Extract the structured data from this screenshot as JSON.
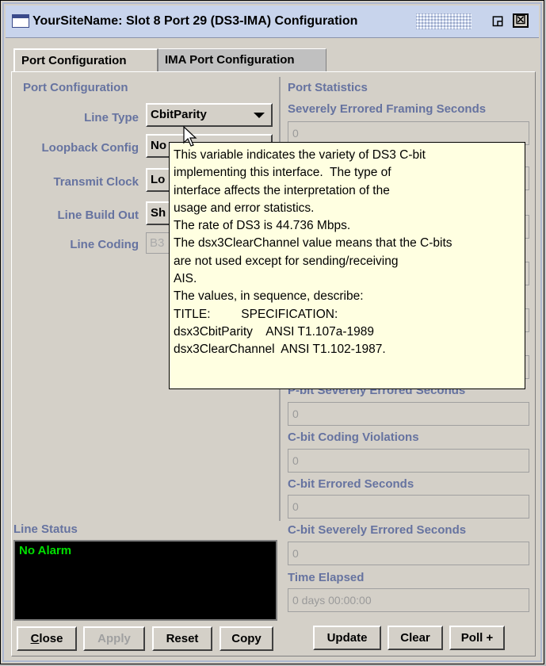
{
  "window": {
    "title": "YourSiteName: Slot 8 Port 29 (DS3-IMA) Configuration",
    "restore_glyph": "◲",
    "close_glyph": "☒"
  },
  "tabs": [
    {
      "label": "Port Configuration",
      "active": true
    },
    {
      "label": "IMA Port Configuration",
      "active": false
    }
  ],
  "port_config": {
    "heading": "Port Configuration",
    "fields": [
      {
        "label": "Line Type",
        "value": "CbitParity"
      },
      {
        "label": "Loopback Config",
        "value": "No"
      },
      {
        "label": "Transmit Clock",
        "value": "Lo"
      },
      {
        "label": "Line Build Out",
        "value": "Sh"
      },
      {
        "label": "Line Coding",
        "value": "B3"
      }
    ]
  },
  "port_stats": {
    "heading": "Port Statistics",
    "items": [
      {
        "label": "Severely Errored Framing Seconds",
        "value": "0"
      },
      {
        "label": "",
        "value": ""
      },
      {
        "label": "",
        "value": ""
      },
      {
        "label": "",
        "value": ""
      },
      {
        "label": "",
        "value": ""
      },
      {
        "label": "",
        "value": ""
      },
      {
        "label": "P-bit Severely Errored Seconds",
        "value": "0"
      },
      {
        "label": "C-bit Coding Violations",
        "value": "0"
      },
      {
        "label": "C-bit Errored Seconds",
        "value": "0"
      },
      {
        "label": "C-bit Severely Errored Seconds",
        "value": "0"
      },
      {
        "label": "Time Elapsed",
        "value": "0 days  00:00:00"
      }
    ]
  },
  "line_status": {
    "heading": "Line Status",
    "alarm_text": "No Alarm"
  },
  "buttons_left": {
    "close_u": "C",
    "close_rest": "lose",
    "apply": "Apply",
    "reset": "Reset",
    "copy": "Copy"
  },
  "buttons_right": {
    "update": "Update",
    "clear": "Clear",
    "poll": "Poll +"
  },
  "tooltip": {
    "lines": [
      "This variable indicates the variety of DS3 C-bit",
      "implementing this interface.  The type of",
      "interface affects the interpretation of the",
      "usage and error statistics.",
      "The rate of DS3 is 44.736 Mbps.",
      "The dsx3ClearChannel value means that the C-bits",
      "are not used except for sending/receiving",
      "AIS.",
      "The values, in sequence, describe:",
      "TITLE:         SPECIFICATION:",
      "dsx3CbitParity    ANSI T1.107a-1989",
      "dsx3ClearChannel  ANSI T1.102-1987."
    ]
  }
}
